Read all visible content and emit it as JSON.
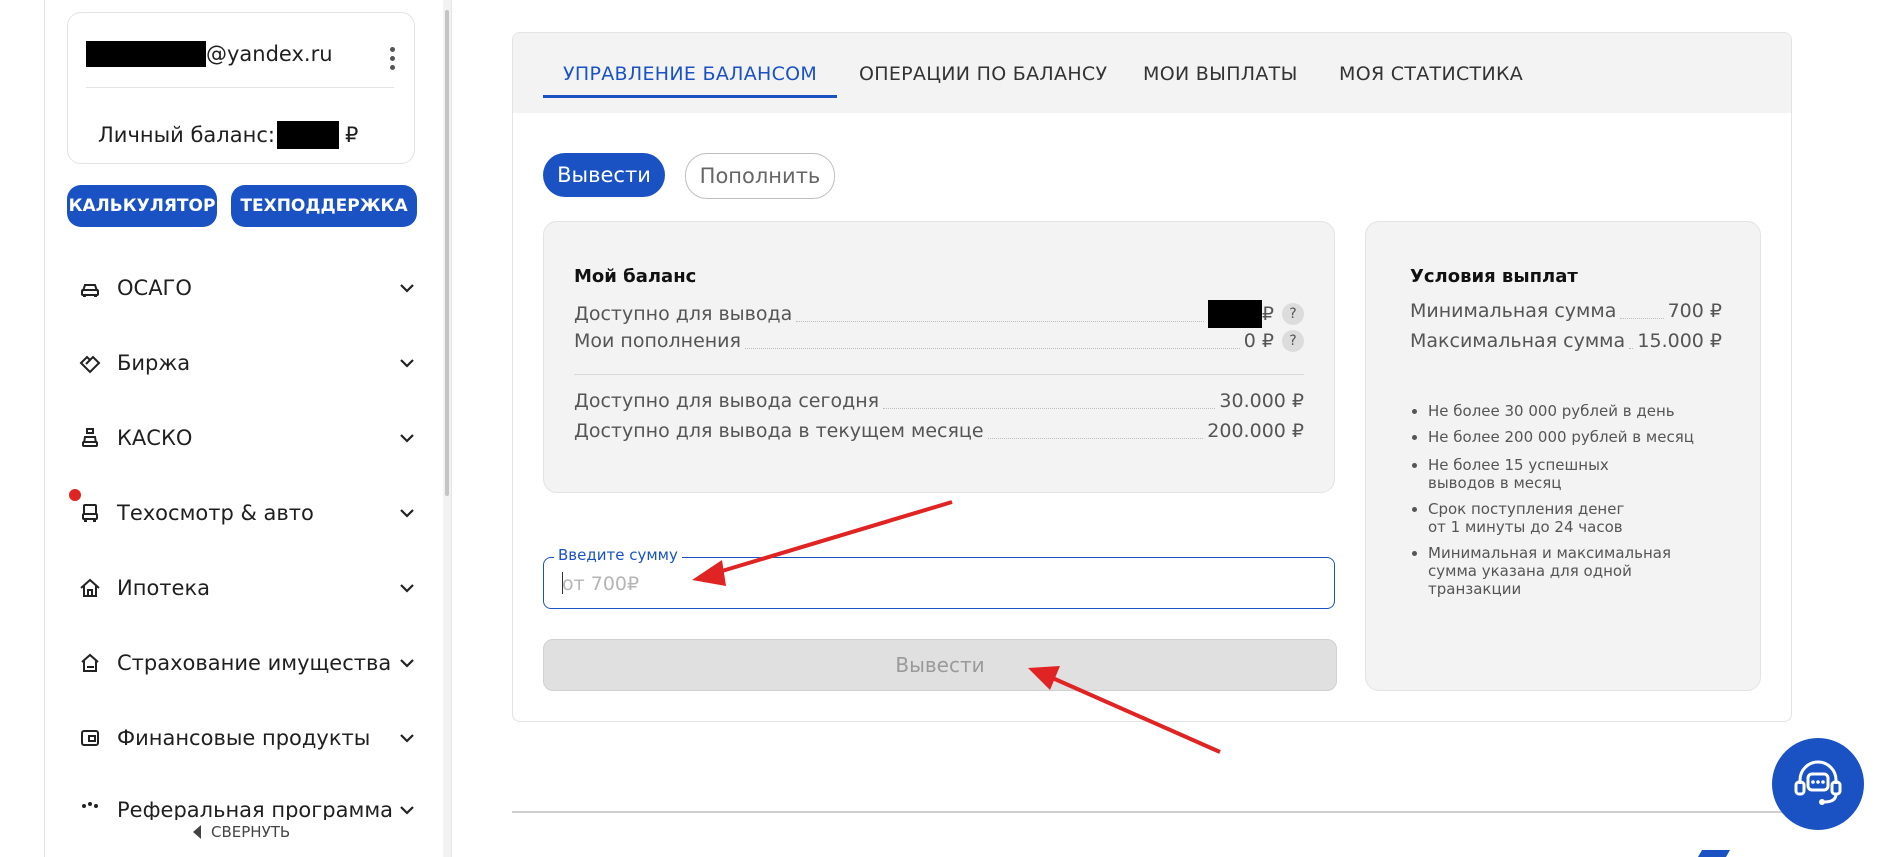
{
  "sidebar": {
    "email_suffix": "@yandex.ru",
    "balance_label": "Личный баланс:",
    "balance_currency": "₽",
    "calculator_label": "КАЛЬКУЛЯТОР",
    "support_label": "ТЕХПОДДЕРЖКА",
    "items": [
      {
        "label": "ОСАГО",
        "icon": "car-icon"
      },
      {
        "label": "Биржа",
        "icon": "handshake-icon"
      },
      {
        "label": "КАСКО",
        "icon": "car-shield-icon"
      },
      {
        "label": "Техосмотр & авто",
        "icon": "inspection-car-icon"
      },
      {
        "label": "Ипотека",
        "icon": "house-icon"
      },
      {
        "label": "Страхование имущества",
        "icon": "property-insurance-icon"
      },
      {
        "label": "Финансовые продукты",
        "icon": "wallet-icon"
      },
      {
        "label": "Реферальная программа",
        "icon": "referral-icon"
      }
    ],
    "collapse_label": "СВЕРНУТЬ"
  },
  "tabs": [
    {
      "label": "УПРАВЛЕНИЕ БАЛАНСОМ",
      "active": true
    },
    {
      "label": "ОПЕРАЦИИ ПО БАЛАНСУ",
      "active": false
    },
    {
      "label": "МОИ ВЫПЛАТЫ",
      "active": false
    },
    {
      "label": "МОЯ СТАТИСТИКА",
      "active": false
    }
  ],
  "actions": {
    "withdraw_label": "Вывести",
    "topup_label": "Пополнить"
  },
  "balance_card": {
    "title": "Мой баланс",
    "available_label": "Доступно для вывода",
    "available_currency": "₽",
    "topups_label": "Мои пополнения",
    "topups_value": "0 ₽",
    "today_label": "Доступно для вывода сегодня",
    "today_value": "30.000 ₽",
    "month_label": "Доступно для вывода в текущем месяце",
    "month_value": "200.000 ₽",
    "help_mark": "?"
  },
  "conditions_card": {
    "title": "Условия выплат",
    "min_label": "Минимальная сумма",
    "min_value": "700 ₽",
    "max_label": "Максимальная сумма",
    "max_value": "15.000 ₽",
    "bullets": [
      "Не более 30 000 рублей в день",
      "Не более 200 000 рублей в месяц",
      "Не более 15 успешных выводов в месяц",
      "Срок поступления денег от 1 минуты до 24 часов",
      "Минимальная и максимальная сумма указана для одной транзакции"
    ]
  },
  "amount_input": {
    "label": "Введите сумму",
    "placeholder": "от 700₽",
    "value": ""
  },
  "submit_label": "Вывести",
  "colors": {
    "accent": "#1a52c4",
    "annotation": "#e02424",
    "panel_bg": "#f3f3f3"
  }
}
